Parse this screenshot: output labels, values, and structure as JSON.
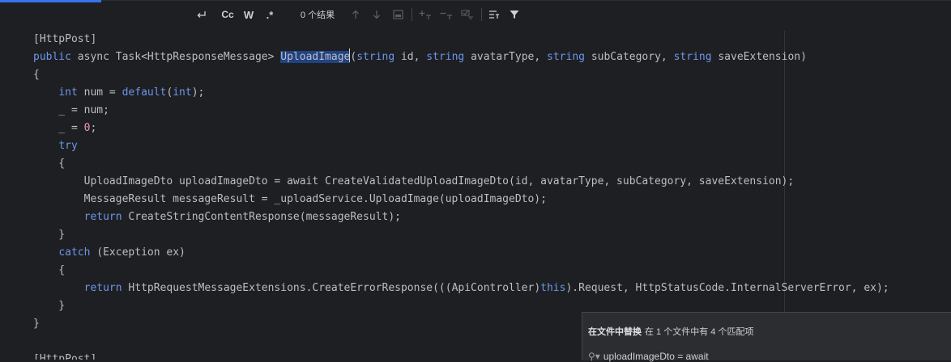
{
  "toolbar": {
    "icons": [
      "wrap-icon",
      "match-case",
      "whole-word",
      "regex",
      "prev-occurrence-icon",
      "next-occurrence-icon",
      "select-all-occurrences-icon",
      "add-selection-icon",
      "remove-selection-icon",
      "select-all-icon",
      "filter-options-icon",
      "filter-icon"
    ],
    "match_case_label": "Cc",
    "whole_word_label": "W",
    "regex_label": ".*",
    "result_text": "0 个结果"
  },
  "code": {
    "lines": [
      {
        "tokens": [
          {
            "t": "[HttpPost]",
            "c": "plain"
          }
        ]
      },
      {
        "tokens": [
          {
            "t": "public ",
            "c": "k"
          },
          {
            "t": "async ",
            "c": "plain"
          },
          {
            "t": "Task<HttpResponseMessage> ",
            "c": "plain"
          },
          {
            "t": "UploadImage",
            "c": "sel"
          },
          {
            "t": "",
            "c": "caret"
          },
          {
            "t": "(",
            "c": "plain"
          },
          {
            "t": "string ",
            "c": "k"
          },
          {
            "t": "id, ",
            "c": "plain"
          },
          {
            "t": "string ",
            "c": "k"
          },
          {
            "t": "avatarType, ",
            "c": "plain"
          },
          {
            "t": "string ",
            "c": "k"
          },
          {
            "t": "subCategory, ",
            "c": "plain"
          },
          {
            "t": "string ",
            "c": "k"
          },
          {
            "t": "saveExtension)",
            "c": "plain"
          }
        ]
      },
      {
        "tokens": [
          {
            "t": "{",
            "c": "plain"
          }
        ]
      },
      {
        "tokens": [
          {
            "t": "    ",
            "c": "plain"
          },
          {
            "t": "int ",
            "c": "k"
          },
          {
            "t": "num = ",
            "c": "plain"
          },
          {
            "t": "default",
            "c": "k"
          },
          {
            "t": "(",
            "c": "plain"
          },
          {
            "t": "int",
            "c": "k"
          },
          {
            "t": ");",
            "c": "plain"
          }
        ]
      },
      {
        "tokens": [
          {
            "t": "    _ = num;",
            "c": "plain"
          }
        ]
      },
      {
        "tokens": [
          {
            "t": "    _ = ",
            "c": "plain"
          },
          {
            "t": "0",
            "c": "n"
          },
          {
            "t": ";",
            "c": "plain"
          }
        ]
      },
      {
        "tokens": [
          {
            "t": "    ",
            "c": "plain"
          },
          {
            "t": "try",
            "c": "k"
          }
        ]
      },
      {
        "tokens": [
          {
            "t": "    {",
            "c": "plain"
          }
        ]
      },
      {
        "tokens": [
          {
            "t": "        UploadImageDto uploadImageDto = await CreateValidatedUploadImageDto(id, avatarType, subCategory, saveExtension);",
            "c": "plain"
          }
        ]
      },
      {
        "tokens": [
          {
            "t": "        MessageResult messageResult = _uploadService.UploadImage(uploadImageDto);",
            "c": "plain"
          }
        ]
      },
      {
        "tokens": [
          {
            "t": "        ",
            "c": "plain"
          },
          {
            "t": "return ",
            "c": "k"
          },
          {
            "t": "CreateStringContentResponse(messageResult);",
            "c": "plain"
          }
        ]
      },
      {
        "tokens": [
          {
            "t": "    }",
            "c": "plain"
          }
        ]
      },
      {
        "tokens": [
          {
            "t": "    ",
            "c": "plain"
          },
          {
            "t": "catch ",
            "c": "k"
          },
          {
            "t": "(Exception ex)",
            "c": "plain"
          }
        ]
      },
      {
        "tokens": [
          {
            "t": "    {",
            "c": "plain"
          }
        ]
      },
      {
        "tokens": [
          {
            "t": "        ",
            "c": "plain"
          },
          {
            "t": "return ",
            "c": "k"
          },
          {
            "t": "HttpRequestMessageExtensions.CreateErrorResponse(((ApiController)",
            "c": "plain"
          },
          {
            "t": "this",
            "c": "k"
          },
          {
            "t": ").Request, HttpStatusCode.InternalServerError, ex);",
            "c": "plain"
          }
        ]
      },
      {
        "tokens": [
          {
            "t": "    }",
            "c": "plain"
          }
        ]
      },
      {
        "tokens": [
          {
            "t": "}",
            "c": "plain"
          }
        ]
      },
      {
        "tokens": [
          {
            "t": "",
            "c": "plain"
          }
        ]
      },
      {
        "tokens": [
          {
            "t": "[HttpPost]",
            "c": "plain"
          }
        ]
      }
    ]
  },
  "popup": {
    "title": "在文件中替换",
    "subtitle": "在 1 个文件中有 4 个匹配项",
    "search_icon": "search-icon",
    "search_value": "uploadImageDto = await"
  },
  "colors": {
    "background": "#1e1f22",
    "keyword": "#6c95eb",
    "number": "#ed94c0",
    "selection": "#214283",
    "accent": "#3574f0"
  }
}
